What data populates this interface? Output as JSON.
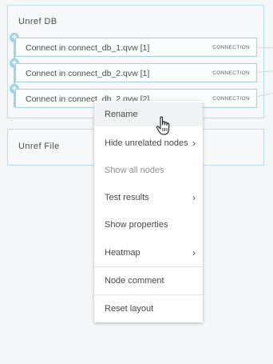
{
  "groups": [
    {
      "title": "Unref DB",
      "nodes": [
        {
          "label": "Connect in connect_db_1.qvw [1]",
          "type": "CONNECTION"
        },
        {
          "label": "Connect in connect_db_2.qvw [1]",
          "type": "CONNECTION"
        },
        {
          "label": "Connect in connect_db_2.qvw [2]",
          "type": "CONNECTION"
        }
      ]
    },
    {
      "title": "Unref File",
      "nodes": []
    }
  ],
  "context_menu": {
    "items": [
      {
        "label": "Rename",
        "submenu": false,
        "disabled": false,
        "hover": true
      },
      {
        "label": "Hide unrelated nodes",
        "submenu": true,
        "disabled": false
      },
      {
        "label": "Show all nodes",
        "submenu": false,
        "disabled": true
      },
      {
        "label": "Test results",
        "submenu": true,
        "disabled": false
      },
      {
        "label": "Show properties",
        "submenu": false,
        "disabled": false
      },
      {
        "label": "Heatmap",
        "submenu": true,
        "disabled": false
      },
      {
        "label": "Node comment",
        "submenu": false,
        "disabled": false
      },
      {
        "label": "Reset layout",
        "submenu": false,
        "disabled": false
      }
    ],
    "submenu_arrow": "›"
  },
  "icons": {
    "expand": "+",
    "cursor": "hand-pointer-icon"
  },
  "colors": {
    "group_border": "#b7dde6",
    "node_border": "#9fd4e0",
    "menu_hover": "#f1f2f3"
  }
}
